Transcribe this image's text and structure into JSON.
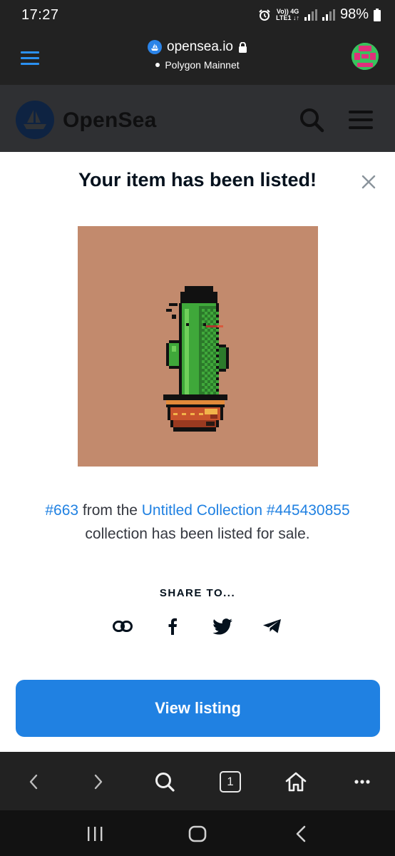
{
  "status_bar": {
    "time": "17:27",
    "network_top": "Vo)) 4G",
    "network_bottom": "LTE1 ↓↑",
    "battery": "98%"
  },
  "browser": {
    "url": "opensea.io",
    "network": "Polygon Mainnet",
    "tab_count": "1"
  },
  "site": {
    "brand": "OpenSea"
  },
  "modal": {
    "title": "Your item has been listed!",
    "item_link": "#663",
    "from_text": " from the ",
    "collection_link": "Untitled Collection #445430855",
    "suffix_text": "collection has been listed for sale.",
    "share_label": "SHARE TO...",
    "share_targets": [
      "copy-link",
      "facebook",
      "twitter",
      "telegram"
    ],
    "view_button": "View listing"
  },
  "colors": {
    "accent": "#2081e2",
    "nft_background": "#c28a6d",
    "chrome_dark": "#222222"
  }
}
